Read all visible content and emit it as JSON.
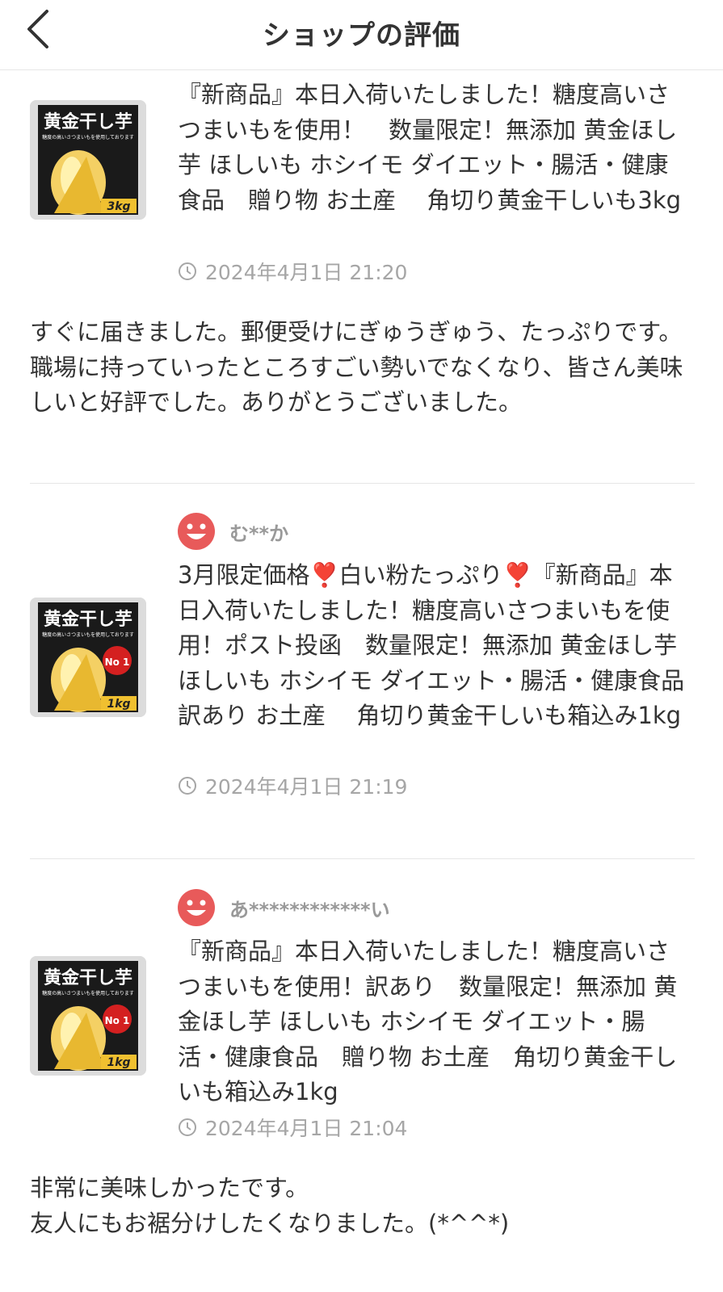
{
  "header": {
    "title": "ショップの評価"
  },
  "reviews": [
    {
      "user": "",
      "product_title": "『新商品』本日入荷いたしました！糖度高いさつまいもを使用！　数量限定！無添加 黄金ほし芋 ほしいも ホシイモ ダイエット・腸活・健康食品　贈り物 お土産　 角切り黄金干しいも3kg",
      "date": "2024年4月1日 21:20",
      "thumbnail": {
        "title": "黄金干し芋",
        "subtitle": "糖度の高いさつまいもを使用しております",
        "weight": "3kg",
        "badge": ""
      },
      "comment_lines": [
        "すぐに届きました。郵便受けにぎゅうぎゅう、たっぷりです。",
        "職場に持っていったところすごい勢いでなくなり、皆さん美味しいと好評でした。ありがとうございました。"
      ]
    },
    {
      "user": "む**か",
      "product_title": "3月限定価格❣️白い粉たっぷり❣️『新商品』本日入荷いたしました！糖度高いさつまいもを使用！ポスト投函　数量限定！無添加 黄金ほし芋 ほしいも ホシイモ ダイエット・腸活・健康食品　訳あり お土産　 角切り黄金干しいも箱込み1kg",
      "date": "2024年4月1日 21:19",
      "thumbnail": {
        "title": "黄金干し芋",
        "subtitle": "糖度の高いさつまいもを使用しております",
        "weight": "1kg",
        "badge": "No 1"
      },
      "comment_lines": []
    },
    {
      "user": "あ************い",
      "product_title": "『新商品』本日入荷いたしました！糖度高いさつまいもを使用！訳あり　数量限定！無添加 黄金ほし芋 ほしいも ホシイモ ダイエット・腸活・健康食品　贈り物 お土産　角切り黄金干しいも箱込み1kg",
      "date": "2024年4月1日 21:04",
      "thumbnail": {
        "title": "黄金干し芋",
        "subtitle": "糖度の高いさつまいもを使用しております",
        "weight": "1kg",
        "badge": "No 1"
      },
      "comment_lines": [
        "非常に美味しかったです。",
        "友人にもお裾分けしたくなりました。(*^^*)"
      ]
    }
  ],
  "colors": {
    "avatar": "#e85a5a",
    "text": "#333333",
    "muted": "#a6a6a6",
    "divider": "#e6e6e6"
  }
}
